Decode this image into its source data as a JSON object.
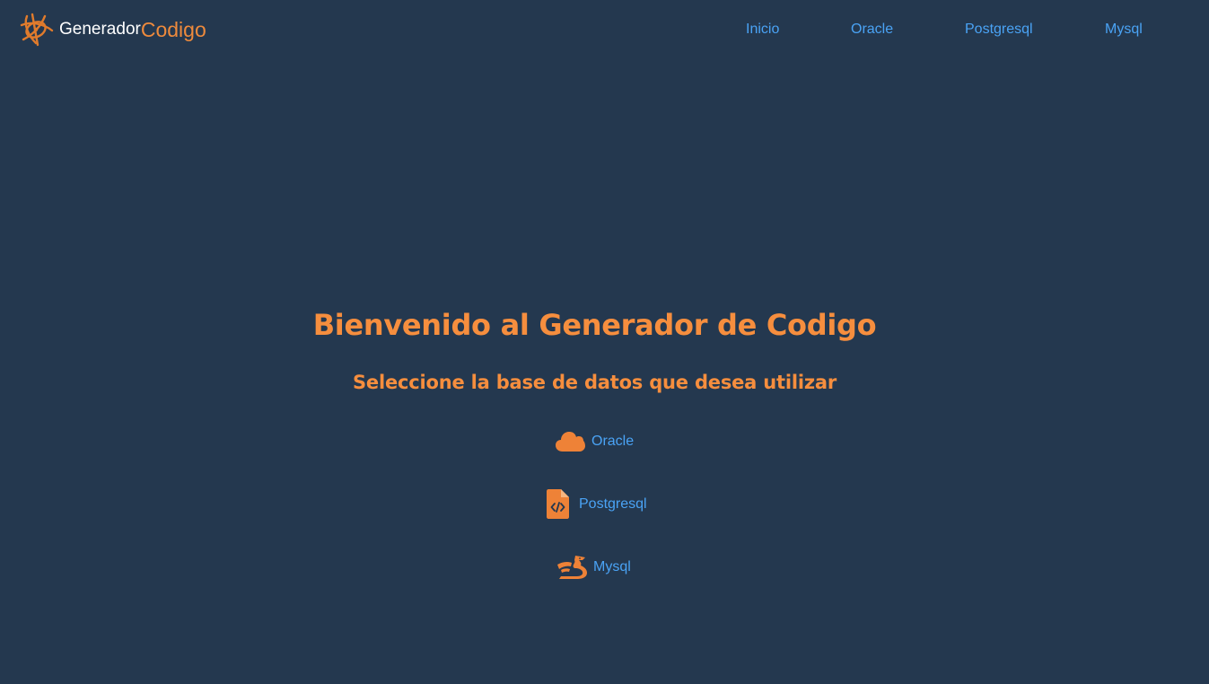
{
  "brand": {
    "name_part1": "Generador",
    "name_part2": "Codigo",
    "logo_icon": "tangled-star-logo-icon"
  },
  "nav": {
    "items": [
      {
        "label": "Inicio"
      },
      {
        "label": "Oracle"
      },
      {
        "label": "Postgresql"
      },
      {
        "label": "Mysql"
      }
    ]
  },
  "main": {
    "title": "Bienvenido al Generador de Codigo",
    "subtitle": "Seleccione la base de datos que desea utilizar",
    "options": [
      {
        "label": "Oracle",
        "icon": "cloud-icon"
      },
      {
        "label": "Postgresql",
        "icon": "file-code-icon"
      },
      {
        "label": "Mysql",
        "icon": "dragon-icon"
      }
    ]
  },
  "colors": {
    "background": "#24384f",
    "accent": "#f68e3e",
    "link": "#4aa3f5",
    "brand_text": "#ffffff"
  }
}
